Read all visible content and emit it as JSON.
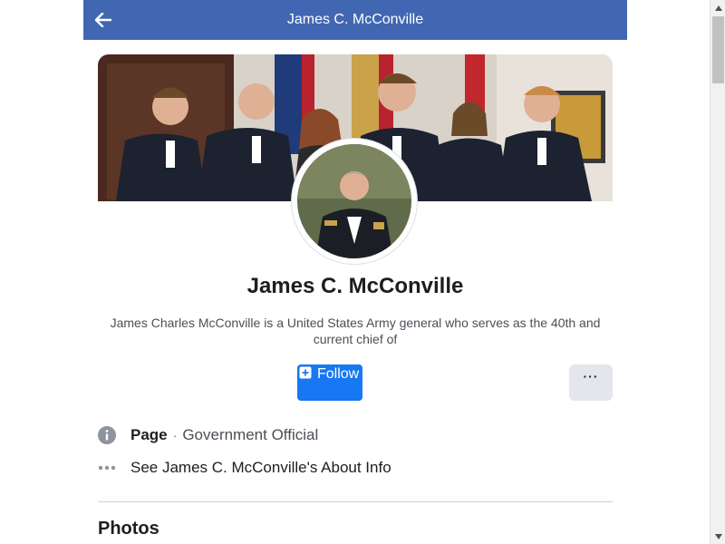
{
  "header": {
    "title": "James C. McConville",
    "back_icon": "arrow-left-icon"
  },
  "profile": {
    "name": "James C. McConville",
    "bio": "James Charles McConville is a United States Army general who serves as the 40th and current chief of"
  },
  "actions": {
    "follow_label": "Follow",
    "follow_icon": "plus-square-icon",
    "more_label": "···",
    "accent_color": "#1877f2"
  },
  "info": {
    "page_label": "Page",
    "separator": "·",
    "category": "Government Official",
    "about_link": "See James C. McConville's About Info",
    "page_icon": "info-icon",
    "about_icon": "more-dots-icon"
  },
  "sections": {
    "photos_title": "Photos"
  },
  "colors": {
    "topbar": "#4267b2",
    "background": "#ffffff"
  }
}
